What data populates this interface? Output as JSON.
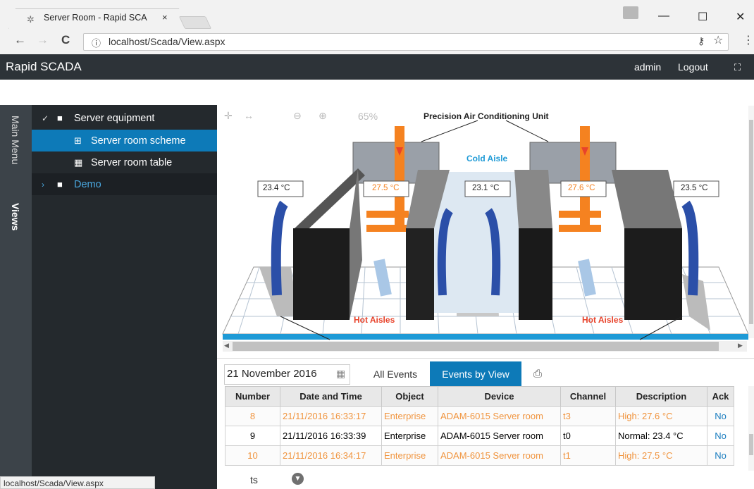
{
  "browser": {
    "tab_title": "Server Room - Rapid SCA",
    "tab_close": "×",
    "url": "localhost/Scada/View.aspx",
    "minimize": "—",
    "maximize": "☐",
    "close": "✕"
  },
  "app": {
    "brand": "Rapid SCADA",
    "user": "admin",
    "logout": "Logout"
  },
  "vtabs": {
    "main_menu": "Main Menu",
    "views": "Views"
  },
  "tree": {
    "items": [
      {
        "label": "Server equipment"
      },
      {
        "label": "Server room scheme"
      },
      {
        "label": "Server room table"
      },
      {
        "label": "Demo"
      }
    ]
  },
  "scheme": {
    "zoom": "65%",
    "title": "Precision Air Conditioning Unit",
    "cold_aisle": "Cold Aisle",
    "hot_aisles_left": "Hot Aisles",
    "hot_aisles_right": "Hot Aisles",
    "temps": [
      {
        "label": "23.4 °C",
        "alarm": false
      },
      {
        "label": "27.5 °C",
        "alarm": true
      },
      {
        "label": "23.1 °C",
        "alarm": false
      },
      {
        "label": "27.6 °C",
        "alarm": true
      },
      {
        "label": "23.5 °C",
        "alarm": false
      }
    ]
  },
  "events": {
    "date": "21 November 2016",
    "tab_all": "All Events",
    "tab_view": "Events by View",
    "label": "ts",
    "columns": [
      "Number",
      "Date and Time",
      "Object",
      "Device",
      "Channel",
      "Description",
      "Ack"
    ],
    "rows": [
      {
        "number": "8",
        "datetime": "21/11/2016 16:33:17",
        "object": "Enterprise",
        "device": "ADAM-6015 Server room",
        "channel": "t3",
        "description": "High: 27.6 °C",
        "ack": "No",
        "alarm": true
      },
      {
        "number": "9",
        "datetime": "21/11/2016 16:33:39",
        "object": "Enterprise",
        "device": "ADAM-6015 Server room",
        "channel": "t0",
        "description": "Normal: 23.4 °C",
        "ack": "No",
        "alarm": false
      },
      {
        "number": "10",
        "datetime": "21/11/2016 16:34:17",
        "object": "Enterprise",
        "device": "ADAM-6015 Server room",
        "channel": "t1",
        "description": "High: 27.5 °C",
        "ack": "No",
        "alarm": true
      }
    ]
  },
  "status_url": "localhost/Scada/View.aspx",
  "colors": {
    "accent": "#0d7ab8",
    "alarm": "#f0943e",
    "header_bg": "#2d3338"
  }
}
